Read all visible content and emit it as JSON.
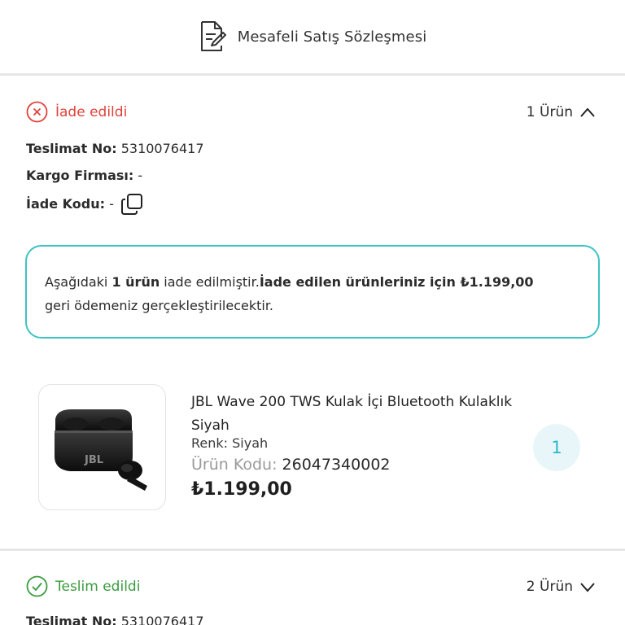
{
  "header": {
    "title": "Mesafeli Satış Sözleşmesi",
    "icon": "document-edit-icon"
  },
  "returned": {
    "status": "İade edildi",
    "status_color": "#e0413a",
    "count": "1 Ürün",
    "delivery_label": "Teslimat No:",
    "delivery_value": "5310076417",
    "cargo_label": "Kargo Firması:",
    "cargo_value": "-",
    "return_code_label": "İade Kodu:",
    "return_code_value": "-",
    "notice": {
      "part1": "Aşağıdaki ",
      "part2": "1 ürün",
      "part3": " iade edilmiştir.",
      "part4": "İade edilen ürünleriniz için ₺1.199,00",
      "part5": "geri ödemeniz gerçekleştirilecektir."
    },
    "product": {
      "title": "JBL Wave 200 TWS Kulak İçi Bluetooth Kulaklık Siyah",
      "color": "Renk: Siyah",
      "code_label": "Ürün Kodu:",
      "code_value": "26047340002",
      "price": "₺1.199,00",
      "quantity": "1",
      "image_logo": "JBL"
    }
  },
  "delivered": {
    "status": "Teslim edildi",
    "status_color": "#3a9b3e",
    "count": "2 Ürün",
    "delivery_label": "Teslimat No:",
    "delivery_value": "5310076417"
  },
  "colors": {
    "accent_teal": "#3cc3c5",
    "qty_bg": "#e8f6fa",
    "qty_text": "#2db7c9"
  }
}
